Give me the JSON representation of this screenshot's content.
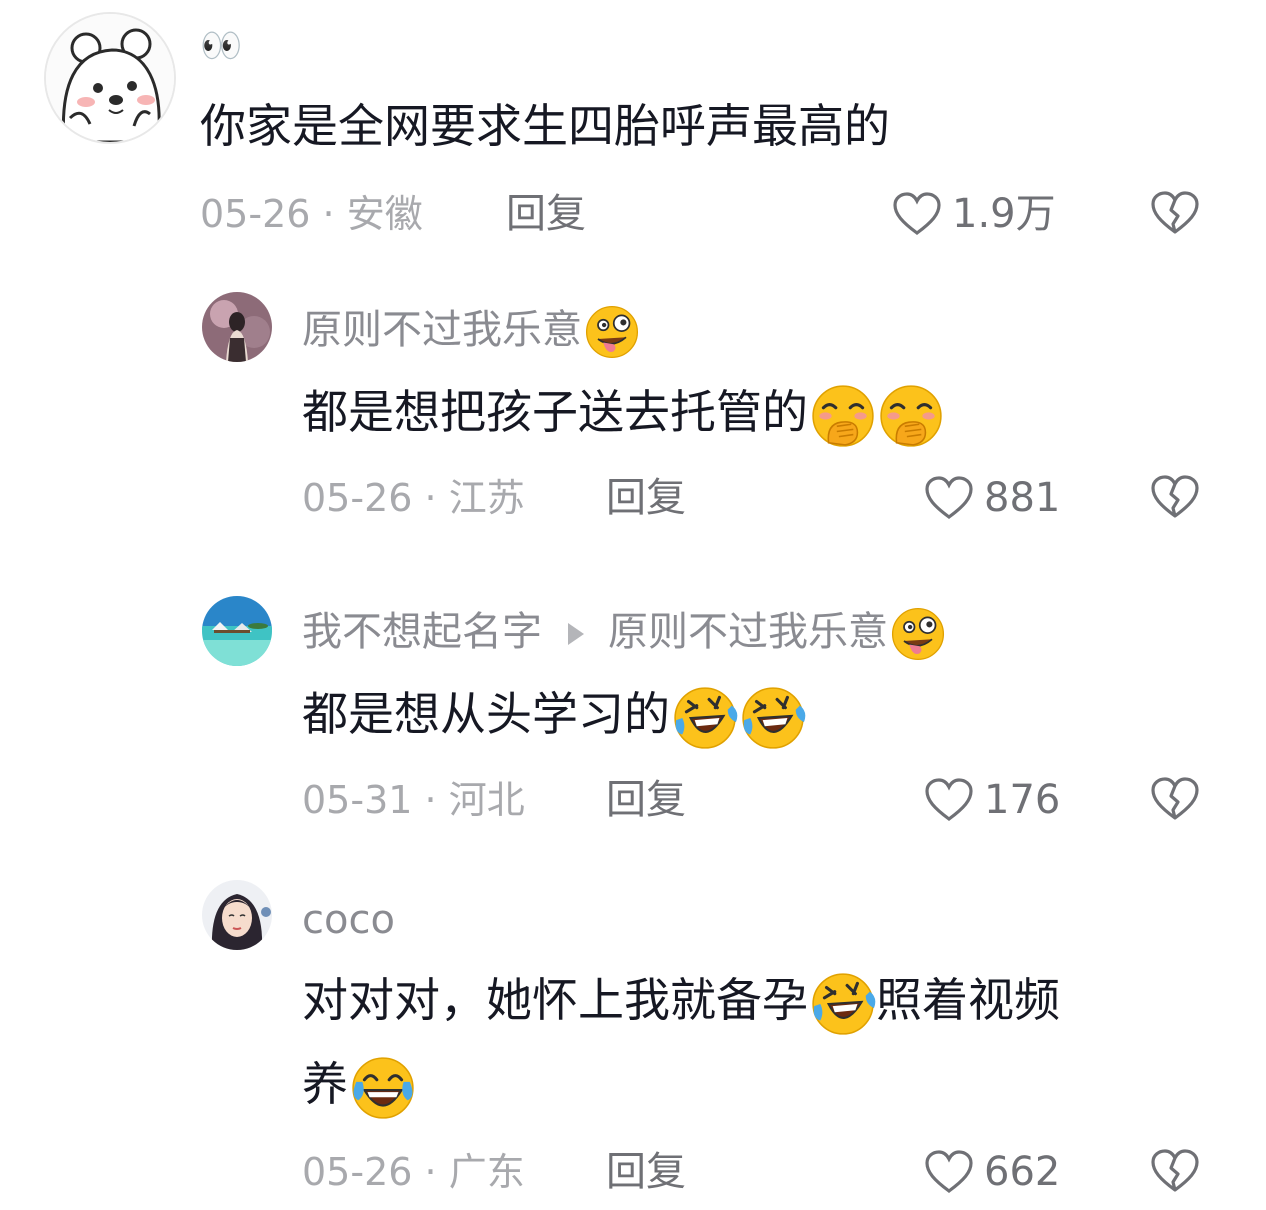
{
  "comments": [
    {
      "name": "👀",
      "text_parts": [
        "你家是全网要求生四胎呼声最高的"
      ],
      "date": "05-26",
      "location": "安徽",
      "reply_label": "回复",
      "likes": "1.9万"
    },
    {
      "name": "原则不过我乐意",
      "text_parts": [
        "都是想把孩子送去托管的"
      ],
      "date": "05-26",
      "location": "江苏",
      "reply_label": "回复",
      "likes": "881"
    },
    {
      "name": "我不想起名字",
      "reply_to": "原则不过我乐意",
      "text_parts": [
        "都是想从头学习的"
      ],
      "date": "05-31",
      "location": "河北",
      "reply_label": "回复",
      "likes": "176"
    },
    {
      "name": "coco",
      "text_parts": [
        "对对对，她怀上我就备孕",
        "照着视频",
        "养"
      ],
      "date": "05-26",
      "location": "广东",
      "reply_label": "回复",
      "likes": "662"
    }
  ],
  "separator": "·",
  "colors": {
    "text": "#161823",
    "name": "#8a8b91",
    "meta": "#a8a9ad",
    "emoji_yellow": "#fcc21b"
  }
}
